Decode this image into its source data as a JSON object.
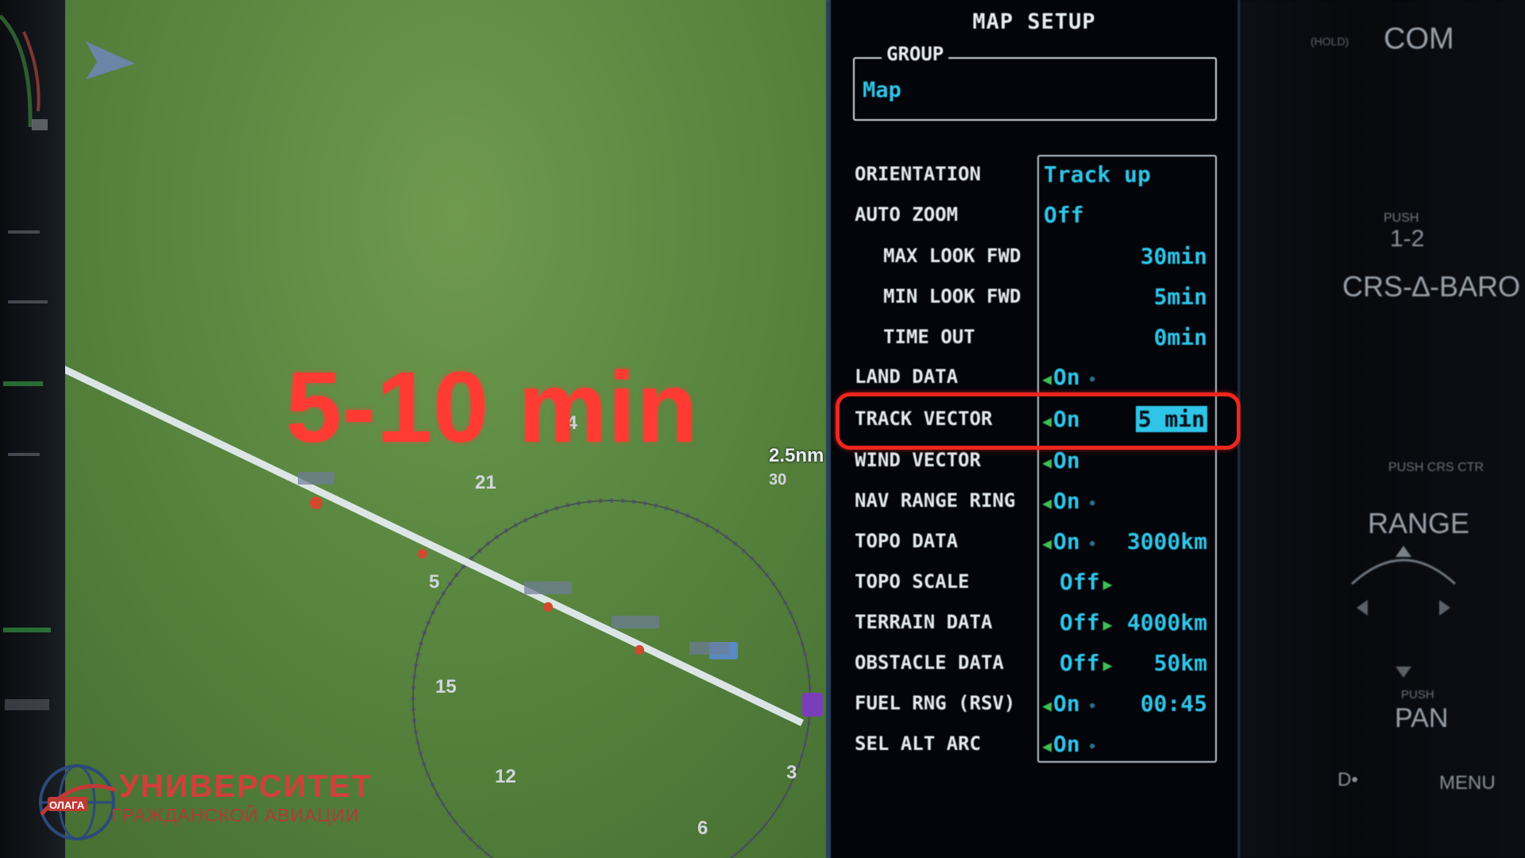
{
  "overlay": {
    "caption": "5-10 min",
    "range_label": "2.5nm"
  },
  "map": {
    "compass_labels": [
      "21",
      "24",
      "5",
      "15",
      "12",
      "3",
      "6",
      "30"
    ]
  },
  "mfd": {
    "title": "MAP SETUP",
    "group": {
      "legend": "GROUP",
      "value": "Map"
    },
    "rows": [
      {
        "label": "ORIENTATION",
        "onoff": "Track up",
        "value": ""
      },
      {
        "label": "AUTO ZOOM",
        "onoff": "Off",
        "value": ""
      },
      {
        "label": "MAX LOOK FWD",
        "onoff": "",
        "value": "30min"
      },
      {
        "label": "MIN LOOK FWD",
        "onoff": "",
        "value": "5min"
      },
      {
        "label": "TIME OUT",
        "onoff": "",
        "value": "0min"
      },
      {
        "label": "LAND DATA",
        "onoff": "On",
        "value": ""
      },
      {
        "label": "TRACK VECTOR",
        "onoff": "On",
        "value": "5 min"
      },
      {
        "label": "WIND VECTOR",
        "onoff": "On",
        "value": ""
      },
      {
        "label": "NAV RANGE RING",
        "onoff": "On",
        "value": ""
      },
      {
        "label": "TOPO DATA",
        "onoff": "On",
        "value": "3000km"
      },
      {
        "label": "TOPO SCALE",
        "onoff": "Off",
        "value": ""
      },
      {
        "label": "TERRAIN DATA",
        "onoff": "Off",
        "value": "4000km"
      },
      {
        "label": "OBSTACLE DATA",
        "onoff": "Off",
        "value": "50km"
      },
      {
        "label": "FUEL RNG (RSV)",
        "onoff": "On",
        "value": "00:45"
      },
      {
        "label": "SEL ALT ARC",
        "onoff": "On",
        "value": ""
      }
    ]
  },
  "bezel": {
    "com": "COM",
    "com_sub": "(HOLD)",
    "push_12_small": "PUSH",
    "push_12": "1-2",
    "crs_baro": "CRS-∆-BARO",
    "push_crs_ctr": "PUSH CRS CTR",
    "range": "RANGE",
    "push_pan_small": "PUSH",
    "pan": "PAN",
    "clr_knob": "D•",
    "menu": "MENU"
  },
  "logo": {
    "main": "УНИВЕРСИТЕТ",
    "sub": "ГРАЖДАНСКОЙ АВИАЦИИ",
    "badge": "ОЛАГА"
  },
  "colors": {
    "map_green": "#5d8a42",
    "mfd_cyan": "#2fc4e8",
    "annotation_red": "#f0261e",
    "arrow_green": "#3fbf56"
  }
}
